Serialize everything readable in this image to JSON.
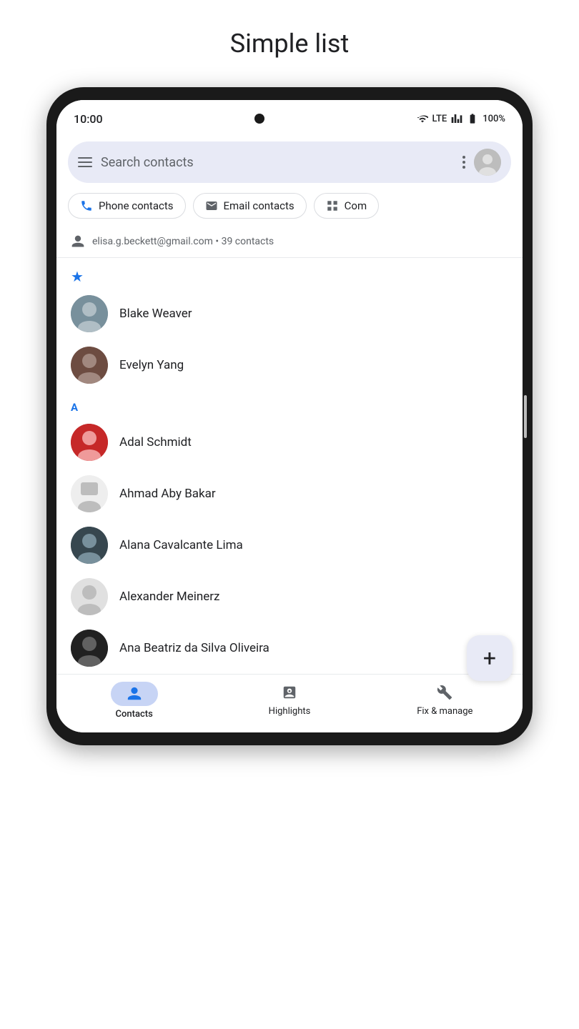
{
  "page": {
    "title": "Simple list"
  },
  "status_bar": {
    "time": "10:00",
    "lte": "LTE",
    "battery": "100%"
  },
  "search": {
    "placeholder": "Search contacts"
  },
  "chips": [
    {
      "label": "Phone contacts",
      "icon": "phone"
    },
    {
      "label": "Email contacts",
      "icon": "email"
    },
    {
      "label": "Com",
      "icon": "grid"
    }
  ],
  "account": {
    "email": "elisa.g.beckett@gmail.com",
    "contacts_count": "39 contacts"
  },
  "contacts": [
    {
      "name": "Blake Weaver",
      "section": "star",
      "avatar_class": "av-blake"
    },
    {
      "name": "Evelyn Yang",
      "section": null,
      "avatar_class": "av-evelyn"
    },
    {
      "name": "Adal Schmidt",
      "section": "A",
      "avatar_class": "av-adal"
    },
    {
      "name": "Ahmad Aby Bakar",
      "section": null,
      "avatar_class": "av-ahmad"
    },
    {
      "name": "Alana Cavalcante Lima",
      "section": null,
      "avatar_class": "av-alana"
    },
    {
      "name": "Alexander Meinerz",
      "section": null,
      "avatar_class": "av-alexander"
    },
    {
      "name": "Ana Beatriz da Silva Oliveira",
      "section": null,
      "avatar_class": "av-ana"
    }
  ],
  "fab": {
    "label": "+"
  },
  "bottom_nav": [
    {
      "label": "Contacts",
      "active": true
    },
    {
      "label": "Highlights",
      "active": false
    },
    {
      "label": "Fix & manage",
      "active": false
    }
  ]
}
